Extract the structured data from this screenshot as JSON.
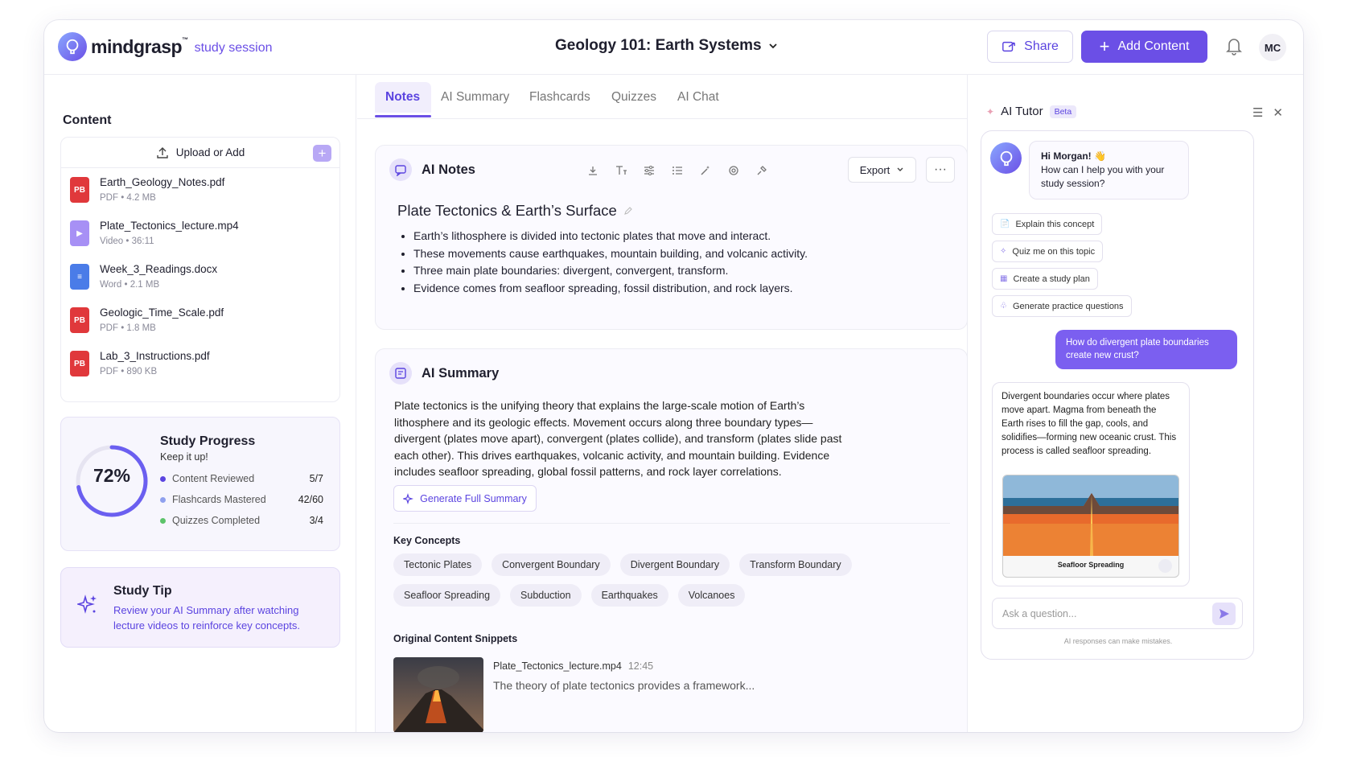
{
  "header": {
    "logo_text": "mindgrasp",
    "logo_tm": "™",
    "logo_sub": "study session",
    "course_title": "Geology 101: Earth Systems",
    "share_label": "Share",
    "add_label": "Add Content",
    "avatar_initials": "MC"
  },
  "content": {
    "heading": "Content",
    "upload_label": "Upload or Add",
    "files": [
      {
        "name": "Earth_Geology_Notes.pdf",
        "type": "PDF",
        "size": "4.2 MB",
        "badge": "PB",
        "color": "#e0383b",
        "icon": "pdf-icon"
      },
      {
        "name": "Plate_Tectonics_lecture.mp4",
        "type": "Video",
        "size": "36:11",
        "badge": "▶",
        "color": "#a790f5",
        "icon": "video-icon"
      },
      {
        "name": "Week_3_Readings.docx",
        "type": "Word",
        "size": "2.1 MB",
        "badge": "≡",
        "color": "#4a7ce8",
        "icon": "word-icon"
      },
      {
        "name": "Geologic_Time_Scale.pdf",
        "type": "PDF",
        "size": "1.8 MB",
        "badge": "PB",
        "color": "#e0383b",
        "icon": "pdf-icon"
      },
      {
        "name": "Lab_3_Instructions.pdf",
        "type": "PDF",
        "size": "890 KB",
        "badge": "PB",
        "color": "#e0383b",
        "icon": "pdf-icon"
      }
    ]
  },
  "progress": {
    "percent": "72%",
    "fraction": 0.72,
    "title": "Study Progress",
    "subtitle": "Keep it up!",
    "rows": [
      {
        "label": "Content Reviewed",
        "value": "5/7",
        "color": "#5b44e0"
      },
      {
        "label": "Flashcards Mastered",
        "value": "42/60",
        "color": "#8fa0ee"
      },
      {
        "label": "Quizzes Completed",
        "value": "3/4",
        "color": "#5cc36a"
      }
    ]
  },
  "tip": {
    "title": "Study Tip",
    "text": "Review your AI Summary after watching lecture videos to reinforce key concepts."
  },
  "tabs": [
    "Notes",
    "AI Summary",
    "Flashcards",
    "Quizzes",
    "AI Chat"
  ],
  "notes": {
    "title": "AI Notes",
    "export_label": "Export",
    "more_label": "···",
    "heading": "Plate Tectonics & Earth’s Surface",
    "bullets": [
      "Earth’s lithosphere is divided into tectonic plates that move and interact.",
      "These movements cause earthquakes, mountain building, and volcanic activity.",
      "Three main plate boundaries: divergent, convergent, transform.",
      "Evidence comes from seafloor spreading, fossil distribution, and rock layers."
    ]
  },
  "summary": {
    "title": "AI Summary",
    "text": "Plate tectonics is the unifying theory that explains the large-scale motion of Earth’s lithosphere and its geologic effects. Movement occurs along three boundary types—divergent (plates move apart), convergent (plates collide), and transform (plates slide past each other). This drives earthquakes, volcanic activity, and mountain building. Evidence includes seafloor spreading, global fossil patterns, and rock layer correlations.",
    "generate_label": "Generate Full Summary",
    "key_concepts_heading": "Key Concepts",
    "key_concepts": [
      "Tectonic Plates",
      "Convergent Boundary",
      "Divergent Boundary",
      "Transform Boundary",
      "Seafloor Spreading",
      "Subduction",
      "Earthquakes",
      "Volcanoes"
    ],
    "snippets_heading": "Original Content Snippets",
    "snippet_file": "Plate_Tectonics_lecture.mp4",
    "snippet_time": "12:45",
    "snippet_text": "The theory of plate tectonics provides a framework..."
  },
  "tutor": {
    "title": "AI Tutor",
    "beta": "Beta",
    "greeting_title": "Hi Morgan! 👋",
    "greeting_body": "How can I help you with your study session?",
    "suggestions": [
      "Explain this concept",
      "Quiz me on this topic",
      "Create a study plan",
      "Generate practice questions"
    ],
    "user_message": "How do divergent plate boundaries create new crust?",
    "bot_reply": "Divergent boundaries occur where plates move apart. Magma from beneath the Earth rises to fill the gap, cools, and solidifies—forming new oceanic crust. This process is called seafloor spreading.",
    "image_caption": "Seafloor Spreading",
    "ask_placeholder": "Ask a question...",
    "disclaimer": "AI responses can make mistakes."
  }
}
